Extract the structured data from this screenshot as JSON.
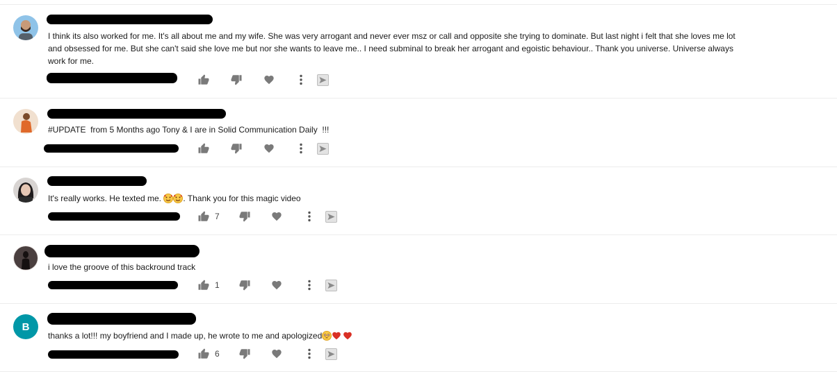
{
  "comments": [
    {
      "avatar_icon": "person-beard-avatar-icon",
      "text": "I think its also worked for me. It's all about me and my wife. She was very arrogant and never ever msz or call and opposite she trying to dominate. But last night i felt that she loves me lot and obsessed for me. But she can't said she love me but nor she wants to leave me.. I need subminal to break her arrogant and egoistic behaviour.. Thank you universe. Universe always work for me.",
      "like_count": ""
    },
    {
      "avatar_icon": "person-orange-dress-avatar-icon",
      "text": "#UPDATE  from 5 Months ago Tony & I are in Solid Communication Daily  !!!",
      "like_count": ""
    },
    {
      "avatar_icon": "person-dark-hair-avatar-icon",
      "text": "It's really works. He texted me. ",
      "text_after": ". Thank you for this magic video",
      "like_count": "7"
    },
    {
      "avatar_icon": "silhouette-avatar-icon",
      "text": "i love the groove of this backround track",
      "like_count": "1"
    },
    {
      "avatar_letter": "B",
      "avatar_color": "#0097a7",
      "text": "thanks a lot!!! my boyfriend and I made up, he wrote to me and apologized",
      "like_count": "6"
    }
  ],
  "icons": {
    "like": "thumbs-up-icon",
    "dislike": "thumbs-down-icon",
    "heart": "heart-icon",
    "more": "more-vertical-icon",
    "reply": "reply-play-icon"
  },
  "colors": {
    "icon": "#7a7a7a",
    "emoji_face": "#f7c948",
    "emoji_heart": "#d93025"
  }
}
